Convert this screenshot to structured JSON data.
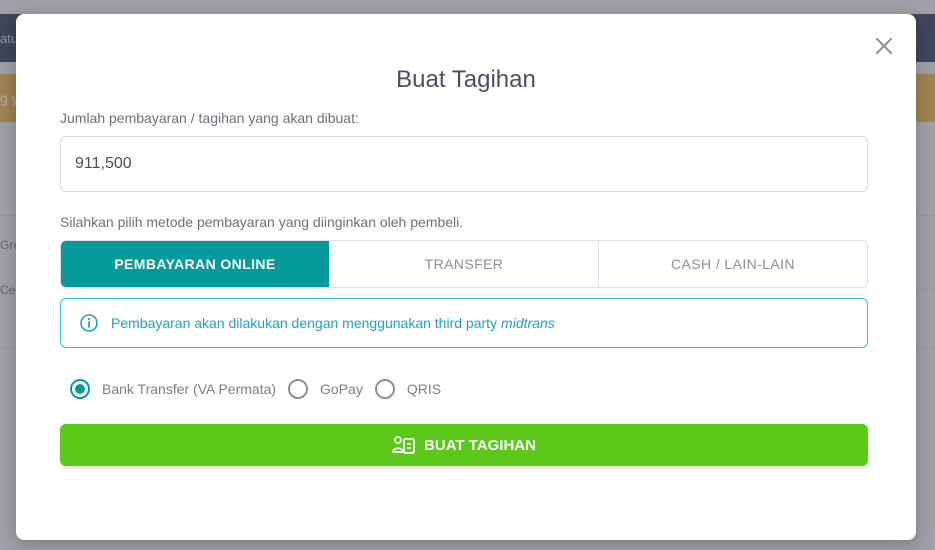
{
  "background": {
    "topbar_text": "atu",
    "alert_text": "g y",
    "row1_text": "Gre",
    "row2_text": "Cer"
  },
  "modal": {
    "title": "Buat Tagihan",
    "amount_label": "Jumlah pembayaran / tagihan yang akan dibuat:",
    "amount_value": "911,500",
    "method_label": "Silahkan pilih metode pembayaran yang diinginkan oleh pembeli.",
    "tabs": [
      {
        "label": "PEMBAYARAN ONLINE",
        "active": true
      },
      {
        "label": "TRANSFER",
        "active": false
      },
      {
        "label": "CASH / LAIN-LAIN",
        "active": false
      }
    ],
    "info": {
      "text": "Pembayaran akan dilakukan dengan menggunakan third party",
      "provider": "midtrans",
      "icon": "info-circle-icon"
    },
    "payment_options": [
      {
        "label": "Bank Transfer (VA Permata)",
        "checked": true
      },
      {
        "label": "GoPay",
        "checked": false
      },
      {
        "label": "QRIS",
        "checked": false
      }
    ],
    "submit_label": "BUAT TAGIHAN",
    "submit_icon": "invoice-user-icon"
  },
  "colors": {
    "accent": "#079a9b",
    "submit": "#5cc81a",
    "info": "#34c3d8"
  }
}
